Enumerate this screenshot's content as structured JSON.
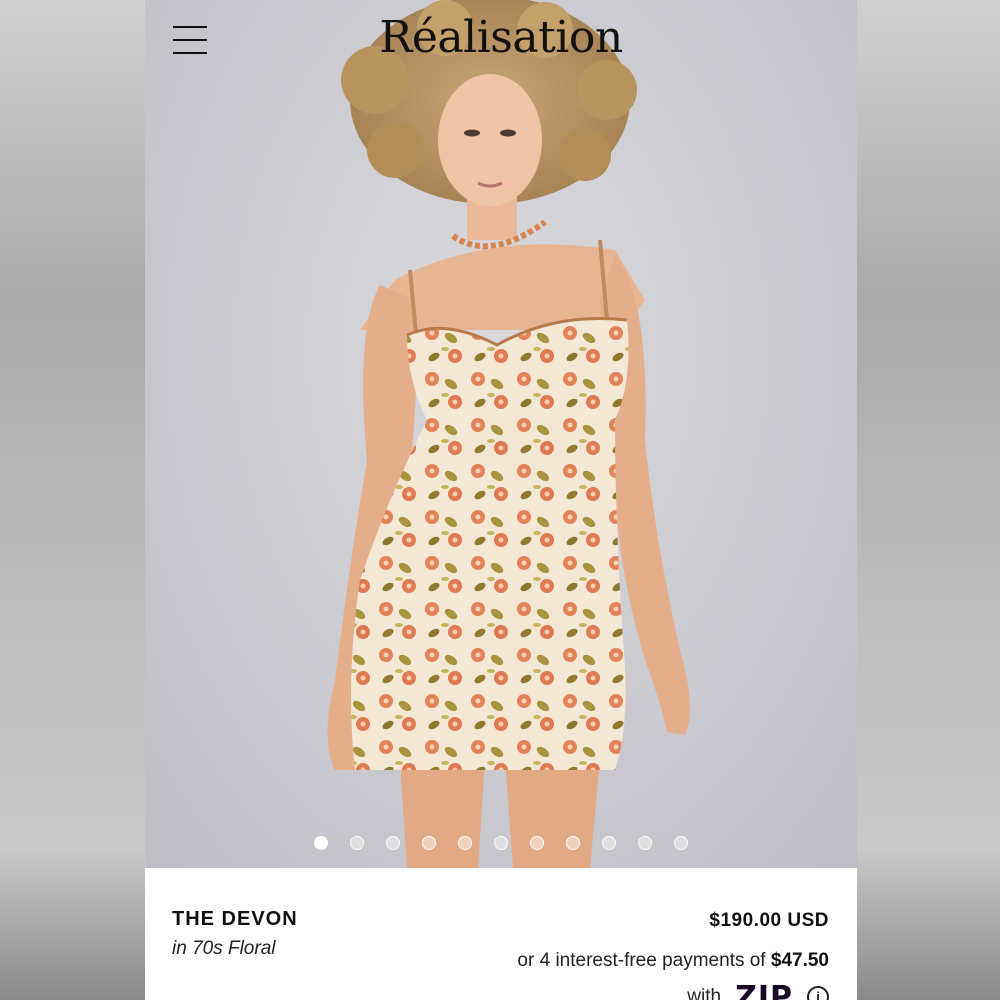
{
  "brand": {
    "name": "Réalisation"
  },
  "gallery": {
    "slide_count": 11,
    "active_index": 0
  },
  "product": {
    "name": "THE DEVON",
    "variant": "in 70s Floral",
    "price": "$190.00 USD",
    "installments_prefix": "or 4 interest-free payments of",
    "installment_amount": "$47.50",
    "with_label": "with",
    "pay_provider": "ZIP"
  },
  "colors": {
    "background": "#c9c9cf",
    "accent_zip": "#7b5cf0",
    "text": "#111111"
  },
  "icons": {
    "menu": "hamburger-menu-icon",
    "info": "info-icon"
  }
}
